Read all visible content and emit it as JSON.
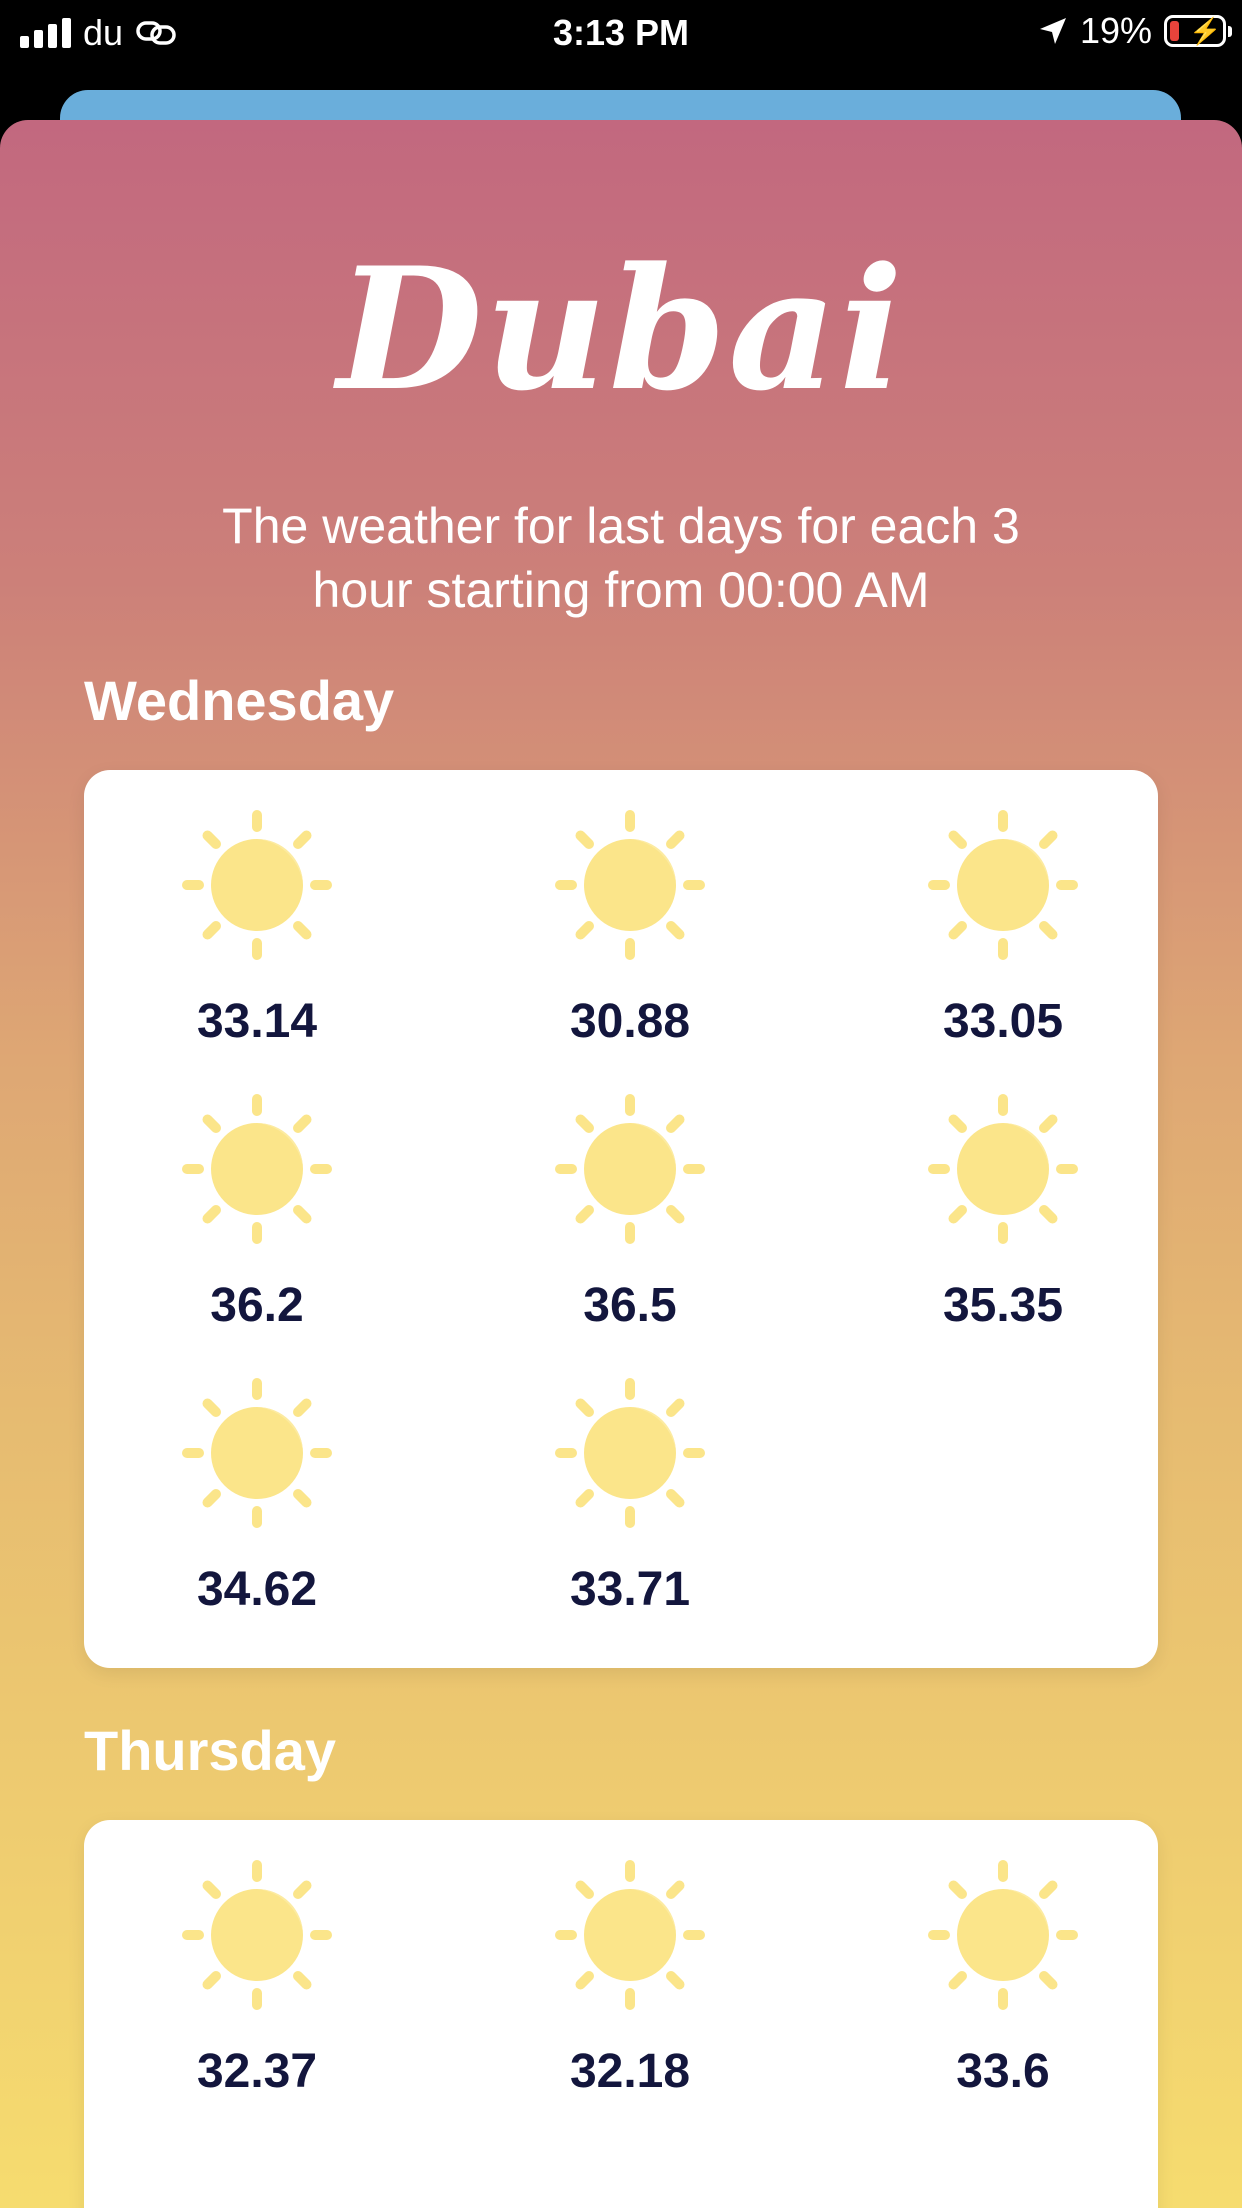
{
  "status_bar": {
    "carrier": "du",
    "time": "3:13 PM",
    "battery": "19%"
  },
  "header": {
    "city": "Dubai",
    "subtitle": "The weather for last days for each 3 hour starting from 00:00 AM"
  },
  "days": [
    {
      "label": "Wednesday",
      "temps": [
        "33.14",
        "30.88",
        "33.05",
        "36.2",
        "36.5",
        "35.35",
        "34.62",
        "33.71"
      ]
    },
    {
      "label": "Thursday",
      "temps": [
        "32.37",
        "32.18",
        "33.6"
      ]
    }
  ],
  "colors": {
    "sun": "#fbe58a",
    "temp_text": "#13163d",
    "gradient_top": "#c2687f",
    "gradient_bottom": "#f6dc6f",
    "back_card": "#6aaedb"
  },
  "icons": {
    "weather": "sun-icon"
  }
}
